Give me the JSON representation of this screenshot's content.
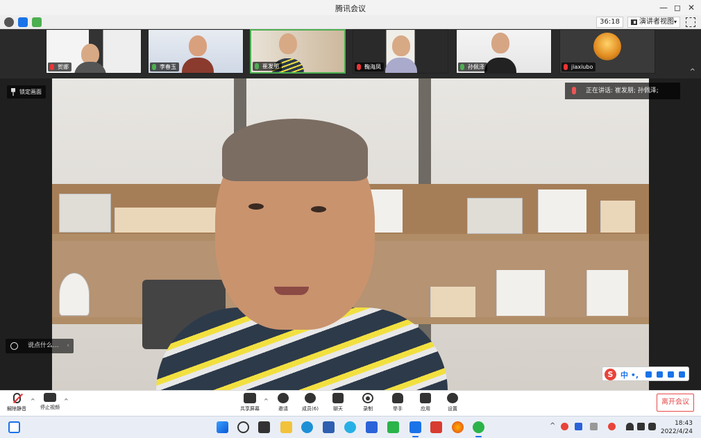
{
  "window": {
    "title": "腾讯会议",
    "controls": [
      "—",
      "◻",
      "✕"
    ]
  },
  "toolbar": {
    "timer": "36:18",
    "view_mode": "演讲者视图",
    "view_caret": "▾"
  },
  "participants": [
    {
      "name": "贺娜",
      "mic": "muted"
    },
    {
      "name": "李春玉",
      "mic": "on"
    },
    {
      "name": "崔发朋",
      "mic": "on"
    },
    {
      "name": "鞠海凤",
      "mic": "muted"
    },
    {
      "name": "孙佩泽",
      "mic": "on"
    },
    {
      "name": "jiaxiubo",
      "mic": "muted"
    }
  ],
  "strip": {
    "collapse_caret": "^"
  },
  "main": {
    "pin_label": "锁定画面",
    "speaking_text": "正在讲话: 崔发朋; 孙佩泽;",
    "chat_placeholder": "说点什么...",
    "chat_arrow": "‹"
  },
  "ime": {
    "logo": "S",
    "lang": "中 •,"
  },
  "controls": {
    "unmute": "解除静音",
    "stop_video": "停止视频",
    "share_screen": "共享屏幕",
    "invite": "邀请",
    "members": "成员(6)",
    "chat": "聊天",
    "record": "录制",
    "raise_hand": "举手",
    "apps": "应用",
    "settings": "设置",
    "leave": "离开会议",
    "caret": "^"
  },
  "taskbar": {
    "time": "18:43",
    "date": "2022/4/24",
    "tray_caret": "^"
  },
  "colors": {
    "accent_green": "#4caf50",
    "leave_red": "#e54b4b",
    "windows_blue": "#1a73e8"
  }
}
